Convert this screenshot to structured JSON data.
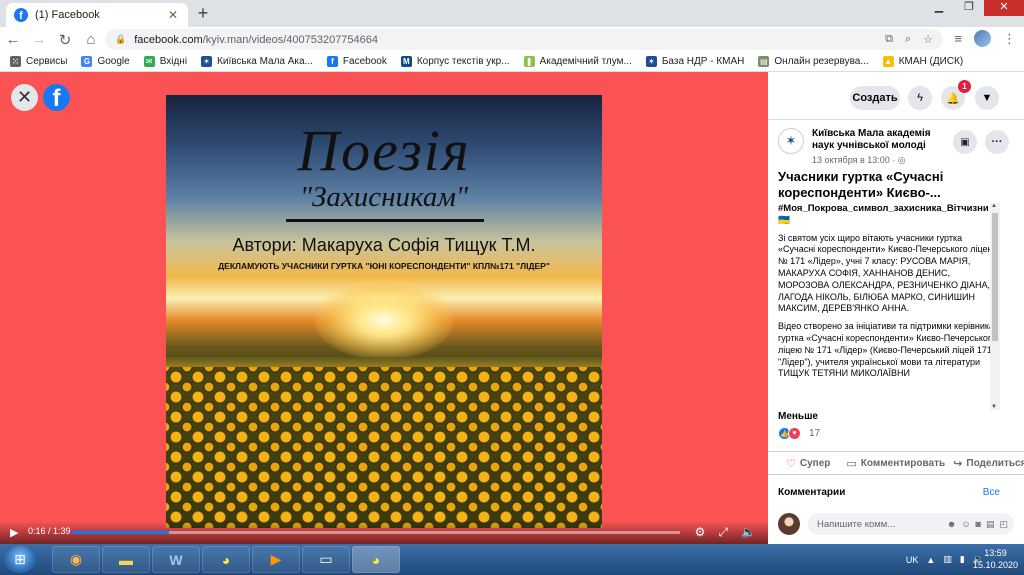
{
  "browser": {
    "tab_title": "(1) Facebook",
    "tab_close": "✕",
    "new_tab": "+",
    "url_host": "facebook.com",
    "url_path": "/kyiv.man/videos/400753207754664",
    "bookmarks": [
      {
        "label": "Сервисы",
        "icon": "apps-grid-icon",
        "color": "#5f6368"
      },
      {
        "label": "Google",
        "icon": "google-icon",
        "color": "#4285f4"
      },
      {
        "label": "Вхідні",
        "icon": "inbox-icon",
        "color": "#34a853"
      },
      {
        "label": "Київська Мала Ака...",
        "icon": "kman-icon",
        "color": "#1d4f91"
      },
      {
        "label": "Facebook",
        "icon": "facebook-icon",
        "color": "#1877f2"
      },
      {
        "label": "Корпус текстів укр...",
        "icon": "corpus-icon",
        "color": "#0b4a8b"
      },
      {
        "label": "Академічний тлум...",
        "icon": "dictionary-icon",
        "color": "#8bc34a"
      },
      {
        "label": "База НДР - КМАН",
        "icon": "kman-icon",
        "color": "#1d4f91"
      },
      {
        "label": "Онлайн резервува...",
        "icon": "booking-icon",
        "color": "#7a8f6a"
      },
      {
        "label": "КМАН (ДИСК)",
        "icon": "drive-icon",
        "color": "#fbbc04"
      }
    ]
  },
  "video": {
    "poem_title": "Поезія",
    "poem_subtitle": "\"Захисникам\"",
    "authors": "Автори: Макаруха Софія Тищук Т.М.",
    "note": "ДЕКЛАМУЮТЬ УЧАСНИКИ ГУРТКА \"ЮНІ КОРЕСПОНДЕНТИ\" КПЛ№171 \"ЛІДЕР\"",
    "time": "0:16 / 1:39",
    "progress": 0.16
  },
  "panel": {
    "create_label": "Создать",
    "notification_count": "1",
    "page_name": "Київська Мала академія наук учнівської молоді",
    "post_date": "13 октября в 13:00 · ",
    "post_title": "Учасники гуртка «Сучасні кореспонденти» Києво-...",
    "hashtag": "#Моя_Покрова_символ_захисника_Вітчизни 🇺🇦",
    "paragraph1": "Зі святом усіх щиро вітають учасники гуртка «Сучасні кореспонденти» Києво-Печерського ліцею № 171 «Лідер», учні 7 класу: РУСОВА МАРІЯ, МАКАРУХА СОФІЯ, ХАННАНОВ ДЕНИС, МОРОЗОВА ОЛЕКСАНДРА, РЕЗНИЧЕНКО ДІАНА, ЛАГОДА НІКОЛЬ, БІЛЮБА МАРКО, СИНИШИН МАКСИМ, ДЕРЕВ'ЯНКО АННА.",
    "paragraph2": "Відео створено за ініціативи та підтримки керівника гуртка «Сучасні кореспонденти» Києво-Печерського ліцею № 171 «Лідер» (Києво-Печерський ліцей 171 \"Лідер\"), учителя української мови та літератури ТИЩУК ТЕТЯНИ МИКОЛАЇВНИ",
    "less_label": "Меньше",
    "reaction_count": "17",
    "like_label": "Супер",
    "comment_label": "Комментировать",
    "share_label": "Поделиться",
    "comments_heading": "Комментарии",
    "comments_all": "Все",
    "comment_placeholder": "Напишите комм..."
  },
  "taskbar": {
    "lang": "UK",
    "time": "13:59",
    "date": "15.10.2020"
  }
}
